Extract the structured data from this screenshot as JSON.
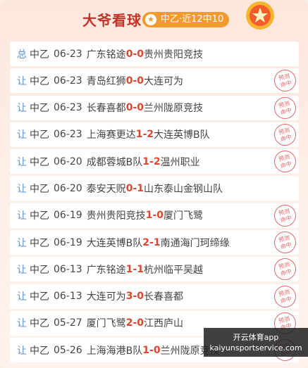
{
  "header": {
    "title": "大爷看球",
    "badge_text": "中乙·近12中10"
  },
  "stamp_lines": [
    "预测",
    "命中"
  ],
  "rows": [
    {
      "tag": "总",
      "league": "中乙",
      "date": "06-23",
      "home": "广东铭途",
      "home_score": "0",
      "away_score": "0",
      "away": "贵州贵阳竞技",
      "hit": false
    },
    {
      "tag": "让",
      "league": "中乙",
      "date": "06-23",
      "home": "青岛红狮",
      "home_score": "0",
      "away_score": "0",
      "away": "大连可为",
      "hit": true
    },
    {
      "tag": "让",
      "league": "中乙",
      "date": "06-23",
      "home": "长春喜都",
      "home_score": "0",
      "away_score": "0",
      "away": "兰州陇原竞技",
      "hit": true
    },
    {
      "tag": "让",
      "league": "中乙",
      "date": "06-23",
      "home": "上海赛更达",
      "home_score": "1",
      "away_score": "2",
      "away": "大连英博B队",
      "hit": true
    },
    {
      "tag": "让",
      "league": "中乙",
      "date": "06-20",
      "home": "成都蓉城B队",
      "home_score": "1",
      "away_score": "2",
      "away": "温州职业",
      "hit": true
    },
    {
      "tag": "让",
      "league": "中乙",
      "date": "06-20",
      "home": "泰安天贶",
      "home_score": "0",
      "away_score": "1",
      "away": "山东泰山金钢山队",
      "hit": false
    },
    {
      "tag": "让",
      "league": "中乙",
      "date": "06-19",
      "home": "贵州贵阳竞技",
      "home_score": "1",
      "away_score": "0",
      "away": "厦门飞鹭",
      "hit": true
    },
    {
      "tag": "让",
      "league": "中乙",
      "date": "06-19",
      "home": "大连英博B队",
      "home_score": "2",
      "away_score": "1",
      "away": "南通海门珂缔缘",
      "hit": true
    },
    {
      "tag": "让",
      "league": "中乙",
      "date": "06-13",
      "home": "广东铭途",
      "home_score": "1",
      "away_score": "1",
      "away": "杭州临平吴越",
      "hit": true
    },
    {
      "tag": "让",
      "league": "中乙",
      "date": "06-13",
      "home": "大连可为",
      "home_score": "3",
      "away_score": "0",
      "away": "长春喜都",
      "hit": true
    },
    {
      "tag": "让",
      "league": "中乙",
      "date": "05-27",
      "home": "厦门飞鹭",
      "home_score": "2",
      "away_score": "0",
      "away": "江西庐山",
      "hit": true
    },
    {
      "tag": "让",
      "league": "中乙",
      "date": "05-26",
      "home": "上海海港B队",
      "home_score": "1",
      "away_score": "0",
      "away": "兰州陇原竞技",
      "hit": true
    }
  ],
  "watermark": {
    "line1": "开云体育app",
    "line2": "kaiyunsportservice.com"
  }
}
